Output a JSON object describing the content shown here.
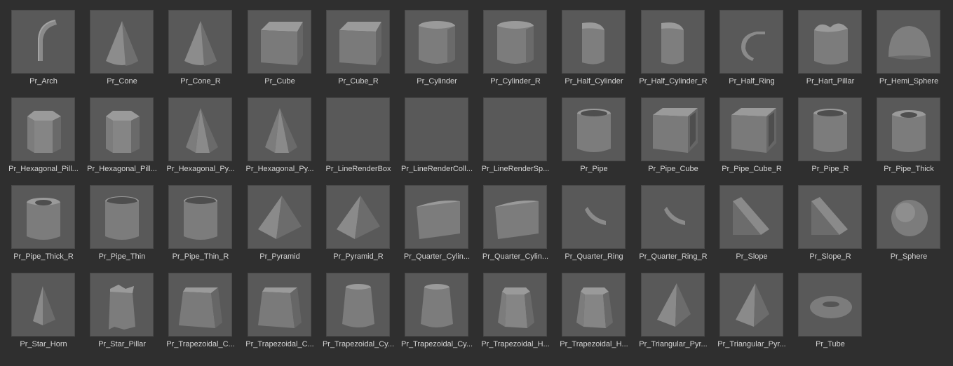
{
  "assets": [
    {
      "label": "Pr_Arch",
      "icon": "arch-icon"
    },
    {
      "label": "Pr_Cone",
      "icon": "cone-icon"
    },
    {
      "label": "Pr_Cone_R",
      "icon": "cone-icon"
    },
    {
      "label": "Pr_Cube",
      "icon": "cube-icon"
    },
    {
      "label": "Pr_Cube_R",
      "icon": "cube-icon"
    },
    {
      "label": "Pr_Cylinder",
      "icon": "cylinder-icon"
    },
    {
      "label": "Pr_Cylinder_R",
      "icon": "cylinder-icon"
    },
    {
      "label": "Pr_Half_Cylinder",
      "icon": "half-cylinder-icon"
    },
    {
      "label": "Pr_Half_Cylinder_R",
      "icon": "half-cylinder-icon"
    },
    {
      "label": "Pr_Half_Ring",
      "icon": "half-ring-icon"
    },
    {
      "label": "Pr_Hart_Pillar",
      "icon": "heart-pillar-icon"
    },
    {
      "label": "Pr_Hemi_Sphere",
      "icon": "hemisphere-icon"
    },
    {
      "label": "Pr_Hexagonal_Pill...",
      "icon": "hexagonal-pillar-icon"
    },
    {
      "label": "Pr_Hexagonal_Pill...",
      "icon": "hexagonal-pillar-icon"
    },
    {
      "label": "Pr_Hexagonal_Py...",
      "icon": "hexagonal-pyramid-icon"
    },
    {
      "label": "Pr_Hexagonal_Py...",
      "icon": "hexagonal-pyramid-icon"
    },
    {
      "label": "Pr_LineRenderBox",
      "icon": "empty-icon"
    },
    {
      "label": "Pr_LineRenderColl...",
      "icon": "empty-icon"
    },
    {
      "label": "Pr_LineRenderSp...",
      "icon": "empty-icon"
    },
    {
      "label": "Pr_Pipe",
      "icon": "pipe-icon"
    },
    {
      "label": "Pr_Pipe_Cube",
      "icon": "pipe-cube-icon"
    },
    {
      "label": "Pr_Pipe_Cube_R",
      "icon": "pipe-cube-icon"
    },
    {
      "label": "Pr_Pipe_R",
      "icon": "pipe-icon"
    },
    {
      "label": "Pr_Pipe_Thick",
      "icon": "pipe-thick-icon"
    },
    {
      "label": "Pr_Pipe_Thick_R",
      "icon": "pipe-thick-icon"
    },
    {
      "label": "Pr_Pipe_Thin",
      "icon": "pipe-thin-icon"
    },
    {
      "label": "Pr_Pipe_Thin_R",
      "icon": "pipe-thin-icon"
    },
    {
      "label": "Pr_Pyramid",
      "icon": "pyramid-icon"
    },
    {
      "label": "Pr_Pyramid_R",
      "icon": "pyramid-icon"
    },
    {
      "label": "Pr_Quarter_Cylin...",
      "icon": "quarter-cylinder-icon"
    },
    {
      "label": "Pr_Quarter_Cylin...",
      "icon": "quarter-cylinder-icon"
    },
    {
      "label": "Pr_Quarter_Ring",
      "icon": "quarter-ring-icon"
    },
    {
      "label": "Pr_Quarter_Ring_R",
      "icon": "quarter-ring-icon"
    },
    {
      "label": "Pr_Slope",
      "icon": "slope-icon"
    },
    {
      "label": "Pr_Slope_R",
      "icon": "slope-icon"
    },
    {
      "label": "Pr_Sphere",
      "icon": "sphere-icon"
    },
    {
      "label": "Pr_Star_Horn",
      "icon": "star-horn-icon"
    },
    {
      "label": "Pr_Star_Pillar",
      "icon": "star-pillar-icon"
    },
    {
      "label": "Pr_Trapezoidal_C...",
      "icon": "trapezoidal-cube-icon"
    },
    {
      "label": "Pr_Trapezoidal_C...",
      "icon": "trapezoidal-cube-icon"
    },
    {
      "label": "Pr_Trapezoidal_Cy...",
      "icon": "trapezoidal-cylinder-icon"
    },
    {
      "label": "Pr_Trapezoidal_Cy...",
      "icon": "trapezoidal-cylinder-icon"
    },
    {
      "label": "Pr_Trapezoidal_H...",
      "icon": "trapezoidal-hexagon-icon"
    },
    {
      "label": "Pr_Trapezoidal_H...",
      "icon": "trapezoidal-hexagon-icon"
    },
    {
      "label": "Pr_Triangular_Pyr...",
      "icon": "triangular-pyramid-icon"
    },
    {
      "label": "Pr_Triangular_Pyr...",
      "icon": "triangular-pyramid-icon"
    },
    {
      "label": "Pr_Tube",
      "icon": "torus-icon"
    }
  ]
}
